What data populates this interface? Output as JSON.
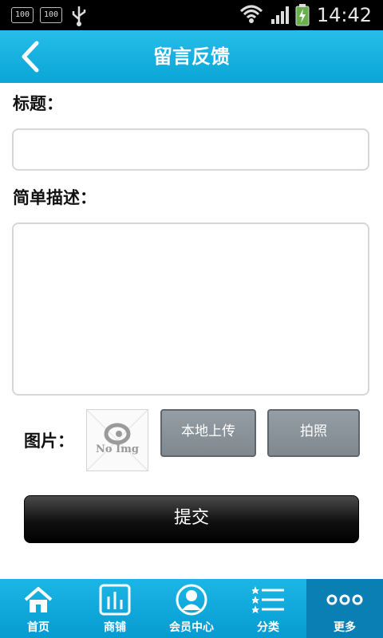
{
  "status_bar": {
    "badges": [
      "100",
      "100"
    ],
    "time": "14:42",
    "icons": [
      "usb-icon",
      "wifi-icon",
      "signal-icon",
      "battery-charging-icon"
    ]
  },
  "header": {
    "title": "留言反馈",
    "back_icon": "chevron-left-icon"
  },
  "form": {
    "title_label": "标题：",
    "title_value": "",
    "description_label": "简单描述：",
    "description_value": "",
    "image_label": "图片：",
    "placeholder_image_text": "No Img",
    "upload_local_label": "本地上传",
    "take_photo_label": "拍照",
    "submit_label": "提交"
  },
  "tabbar": {
    "items": [
      {
        "label": "首页",
        "icon": "home-icon"
      },
      {
        "label": "商铺",
        "icon": "shop-icon"
      },
      {
        "label": "会员中心",
        "icon": "member-icon"
      },
      {
        "label": "分类",
        "icon": "category-list-icon"
      },
      {
        "label": "更多",
        "icon": "more-dots-icon"
      }
    ],
    "active_index": 4
  },
  "colors": {
    "header_blue": "#15b3e4",
    "tab_active": "#0a7fb3",
    "button_gray": "#8a929a",
    "submit_black": "#111111"
  }
}
